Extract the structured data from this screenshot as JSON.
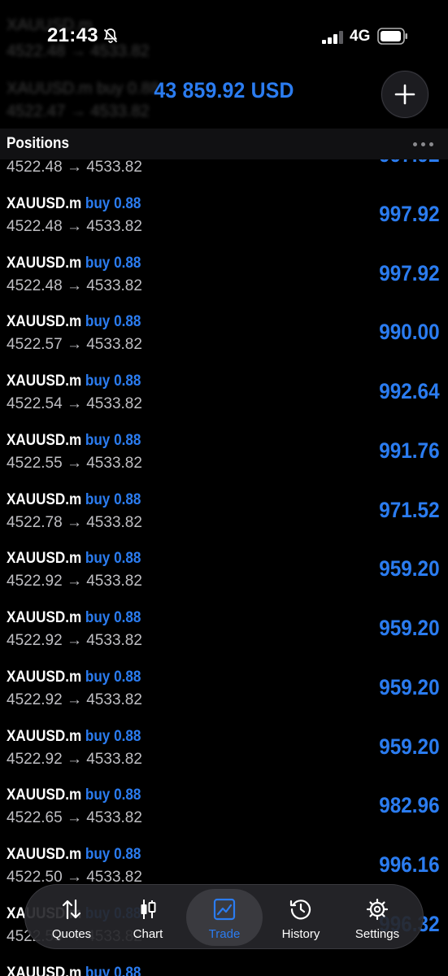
{
  "status_bar": {
    "time": "21:43",
    "network": "4G",
    "icons": [
      "bell-slash-icon",
      "signal-icon",
      "battery-icon"
    ]
  },
  "header": {
    "balance": "43 859.92 USD",
    "add_icon": "plus-icon"
  },
  "positions": {
    "title": "Positions",
    "more_icon": "more-dots-icon",
    "rows": [
      {
        "symbol": "XAUUSD.m",
        "side": "buy 0.88",
        "prices": "4522.48 → 4533.82",
        "profit": "997.92"
      },
      {
        "symbol": "XAUUSD.m",
        "side": "buy 0.88",
        "prices": "4522.48 → 4533.82",
        "profit": "997.92"
      },
      {
        "symbol": "XAUUSD.m",
        "side": "buy 0.88",
        "prices": "4522.48 → 4533.82",
        "profit": "997.92"
      },
      {
        "symbol": "XAUUSD.m",
        "side": "buy 0.88",
        "prices": "4522.57 → 4533.82",
        "profit": "990.00"
      },
      {
        "symbol": "XAUUSD.m",
        "side": "buy 0.88",
        "prices": "4522.54 → 4533.82",
        "profit": "992.64"
      },
      {
        "symbol": "XAUUSD.m",
        "side": "buy 0.88",
        "prices": "4522.55 → 4533.82",
        "profit": "991.76"
      },
      {
        "symbol": "XAUUSD.m",
        "side": "buy 0.88",
        "prices": "4522.78 → 4533.82",
        "profit": "971.52"
      },
      {
        "symbol": "XAUUSD.m",
        "side": "buy 0.88",
        "prices": "4522.92 → 4533.82",
        "profit": "959.20"
      },
      {
        "symbol": "XAUUSD.m",
        "side": "buy 0.88",
        "prices": "4522.92 → 4533.82",
        "profit": "959.20"
      },
      {
        "symbol": "XAUUSD.m",
        "side": "buy 0.88",
        "prices": "4522.92 → 4533.82",
        "profit": "959.20"
      },
      {
        "symbol": "XAUUSD.m",
        "side": "buy 0.88",
        "prices": "4522.92 → 4533.82",
        "profit": "959.20"
      },
      {
        "symbol": "XAUUSD.m",
        "side": "buy 0.88",
        "prices": "4522.65 → 4533.82",
        "profit": "982.96"
      },
      {
        "symbol": "XAUUSD.m",
        "side": "buy 0.88",
        "prices": "4522.50 → 4533.82",
        "profit": "996.16"
      },
      {
        "symbol": "XAUUSD.m",
        "side": "buy 0.88",
        "prices": "4522.50 → 4533.82",
        "profit": "996.32"
      },
      {
        "symbol": "XAUUSD.m",
        "side": "buy 0.88",
        "prices": "",
        "profit": ""
      }
    ]
  },
  "tabbar": {
    "tabs": [
      {
        "label": "Quotes",
        "icon": "quotes-arrows-icon"
      },
      {
        "label": "Chart",
        "icon": "candlestick-icon"
      },
      {
        "label": "Trade",
        "icon": "trade-chart-icon",
        "active": true
      },
      {
        "label": "History",
        "icon": "history-clock-icon"
      },
      {
        "label": "Settings",
        "icon": "settings-gear-icon"
      }
    ]
  },
  "colors": {
    "accent": "#2b7cf0",
    "background": "#000000",
    "tabbar": "#26262a"
  }
}
